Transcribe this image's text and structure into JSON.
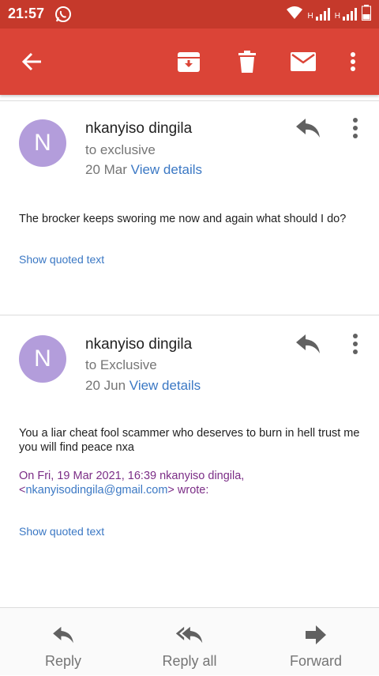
{
  "status_bar": {
    "time": "21:57",
    "icons": [
      "whatsapp-icon",
      "wifi-icon",
      "signal-icon",
      "signal-icon",
      "battery-icon"
    ],
    "network_label_1": "H",
    "network_label_2": "H"
  },
  "app_bar": {
    "icons": [
      "back-arrow-icon",
      "archive-icon",
      "delete-icon",
      "mail-icon",
      "more-vert-icon"
    ]
  },
  "messages": [
    {
      "avatar_initial": "N",
      "sender": "nkanyiso dingila",
      "recipient": "to exclusive",
      "date": "20 Mar",
      "view_details": "View details",
      "body": "The brocker keeps sworing me now and again what should I do?",
      "show_quoted": "Show quoted text"
    },
    {
      "avatar_initial": "N",
      "sender": "nkanyiso dingila",
      "recipient": "to Exclusive",
      "date": "20 Jun",
      "view_details": "View details",
      "body": "You a liar cheat fool scammer who deserves to burn in hell trust me you will find peace nxa",
      "quote_header_prefix": "On Fri, 19 Mar 2021, 16:39 nkanyiso dingila,",
      "quote_header_lt": "<",
      "quote_header_email": "nkanyisodingila@gmail.com",
      "quote_header_suffix": "> wrote:",
      "show_quoted": "Show quoted text"
    }
  ],
  "bottom_bar": {
    "reply": "Reply",
    "reply_all": "Reply all",
    "forward": "Forward"
  },
  "colors": {
    "app_bar": "#db4437",
    "status_bar": "#c5392b",
    "avatar": "#b39ddb",
    "link": "#3b78c4",
    "quote_header": "#7b2d86"
  }
}
